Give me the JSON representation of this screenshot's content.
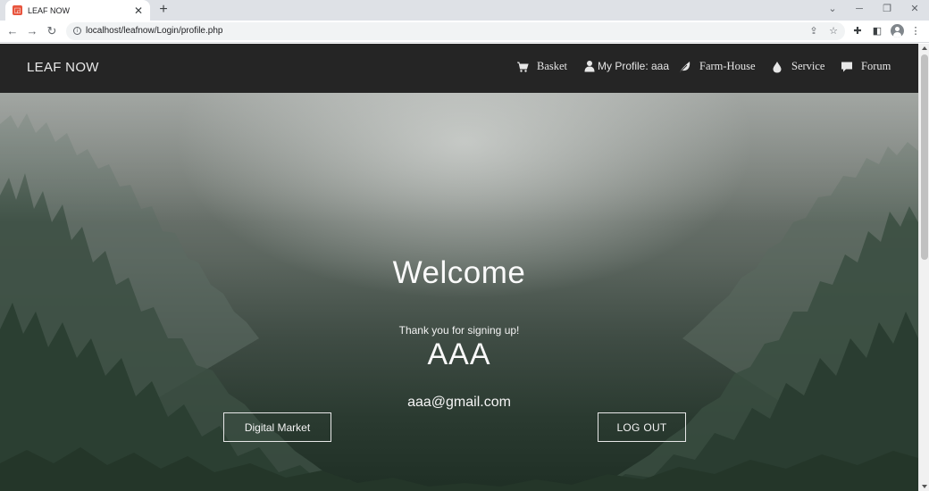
{
  "browser": {
    "tab_title": "LEAF NOW",
    "url": "localhost/leafnow/Login/profile.php"
  },
  "site": {
    "brand": "LEAF NOW",
    "nav": {
      "basket": "Basket",
      "profile": "My Profile: aaa",
      "farmhouse": "Farm-House",
      "service": "Service",
      "forum": "Forum"
    }
  },
  "hero": {
    "heading": "Welcome",
    "thanks": "Thank you for signing up!",
    "username": "AAA",
    "email": "aaa@gmail.com",
    "market_button": "Digital Market",
    "logout_button": "LOG OUT"
  },
  "colors": {
    "navbar_bg": "#252525",
    "hero_text": "#fafafa"
  }
}
